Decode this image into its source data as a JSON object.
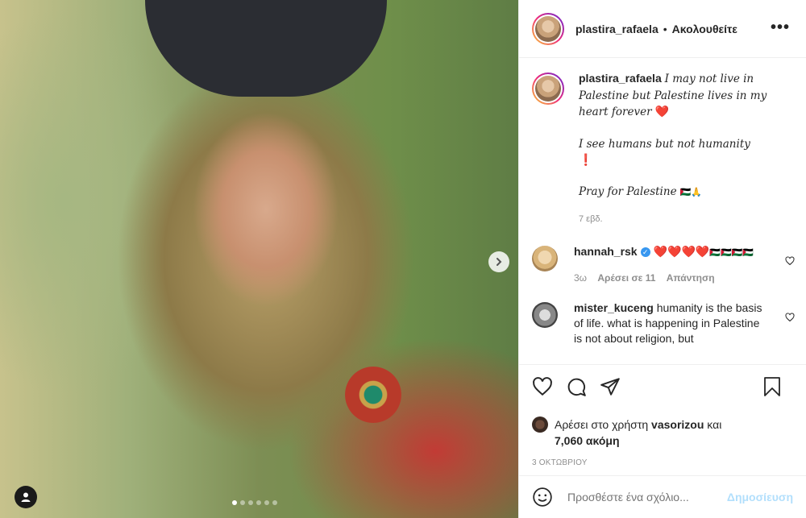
{
  "post": {
    "username": "plastira_rafaela",
    "separator": "•",
    "follow_status": "Ακολουθείτε",
    "more": "•••"
  },
  "caption": {
    "username": "plastira_rafaela",
    "line1": "I may not live in Palestine but Palestine lives in my heart forever",
    "line1_emoji": "❤️",
    "line2": "I see humans but not humanity",
    "line2_emoji": "❗",
    "line3": "Pray for Palestine",
    "line3_emoji": "🇵🇸🙏",
    "time": "7 εβδ."
  },
  "comments": [
    {
      "username": "hannah_rsk",
      "verified": true,
      "text_hearts": "❤️❤️❤️❤️",
      "text_flags": "🇵🇸🇵🇸🇵🇸🇵🇸",
      "time": "3ω",
      "likes": "Αρέσει σε 11",
      "reply": "Απάντηση"
    },
    {
      "username": "mister_kuceng",
      "text": "humanity is the basis of life. what is happening in Palestine is not about religion, but"
    }
  ],
  "likes": {
    "prefix": "Αρέσει στο χρήστη",
    "user": "vasorizou",
    "conj": "και",
    "count": "7,060 ακόμη"
  },
  "date": "3 ΟΚΤΩΒΡΙΟΥ",
  "add_comment": {
    "placeholder": "Προσθέστε ένα σχόλιο...",
    "post_label": "Δημοσίευση"
  },
  "carousel": {
    "total": 6,
    "active": 1
  },
  "icons": [
    "heart-icon",
    "comment-icon",
    "share-icon",
    "bookmark-icon",
    "emoji-icon",
    "chevron-right-icon",
    "user-tag-icon",
    "more-icon",
    "verified-icon"
  ]
}
